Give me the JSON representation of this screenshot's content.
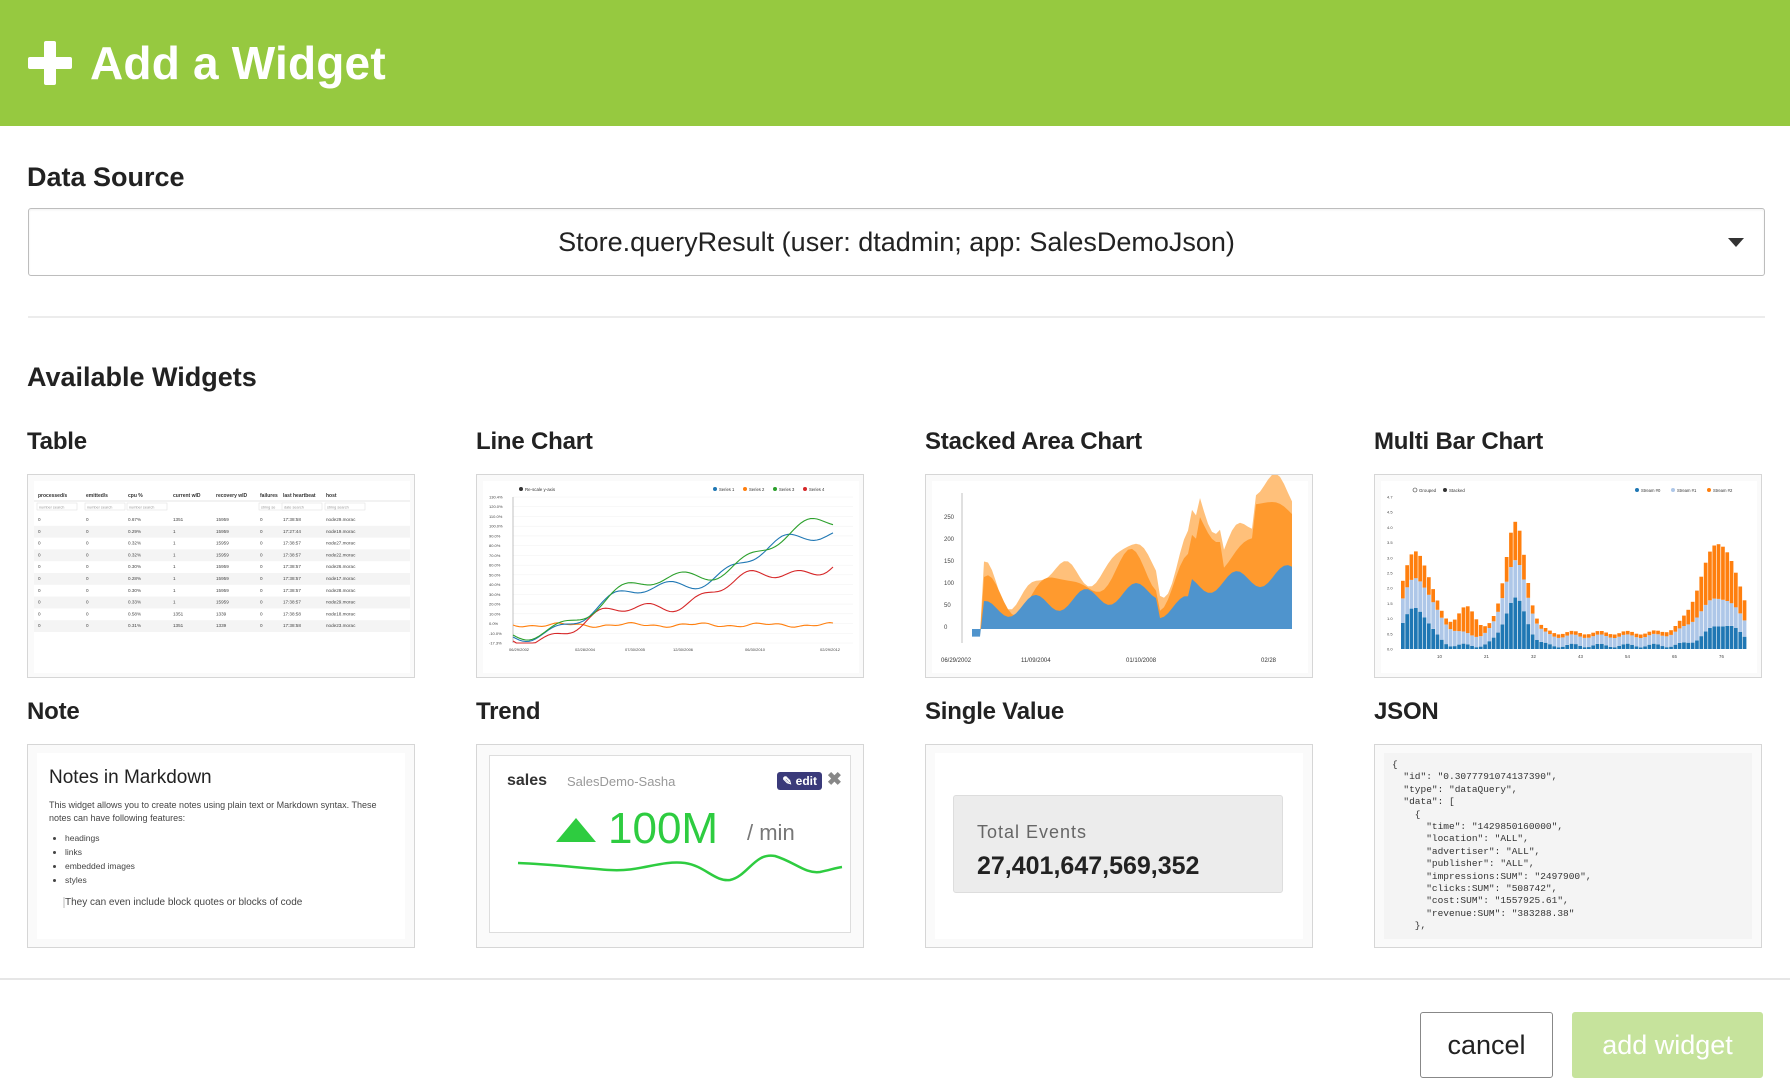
{
  "header": {
    "title": "Add a Widget",
    "icon": "plus-icon",
    "color": "#96c940"
  },
  "data_source": {
    "label": "Data Source",
    "selected": "Store.queryResult (user: dtadmin; app: SalesDemoJson)"
  },
  "available": {
    "label": "Available Widgets"
  },
  "widgets": [
    {
      "name": "Table"
    },
    {
      "name": "Line Chart"
    },
    {
      "name": "Stacked Area Chart"
    },
    {
      "name": "Multi Bar Chart"
    },
    {
      "name": "Note"
    },
    {
      "name": "Trend"
    },
    {
      "name": "Single Value"
    },
    {
      "name": "JSON"
    }
  ],
  "table_preview": {
    "headers": [
      "processed/s",
      "emitted/s",
      "cpu %",
      "current wID",
      "recovery wID",
      "failures",
      "last heartbeat",
      "host"
    ],
    "search": [
      "number search",
      "number search",
      "number search",
      "",
      "",
      "string se",
      "date search",
      "string search"
    ],
    "rows": [
      [
        "0",
        "0",
        "0.67%",
        "1351",
        "15959",
        "0",
        "17:38:58",
        "node29.morac"
      ],
      [
        "0",
        "0",
        "0.29%",
        "1",
        "15959",
        "0",
        "17:27:44",
        "node19.morac"
      ],
      [
        "0",
        "0",
        "0.32%",
        "1",
        "15959",
        "0",
        "17:38:57",
        "node27.morac"
      ],
      [
        "0",
        "0",
        "0.32%",
        "1",
        "15959",
        "0",
        "17:38:57",
        "node22.morac"
      ],
      [
        "0",
        "0",
        "0.30%",
        "1",
        "15959",
        "0",
        "17:38:57",
        "node26.morac"
      ],
      [
        "0",
        "0",
        "0.28%",
        "1",
        "15959",
        "0",
        "17:38:57",
        "node17.morac"
      ],
      [
        "0",
        "0",
        "0.30%",
        "1",
        "15959",
        "0",
        "17:38:57",
        "node28.morac"
      ],
      [
        "0",
        "0",
        "0.33%",
        "1",
        "15959",
        "0",
        "17:38:57",
        "node29.morac"
      ],
      [
        "0",
        "0",
        "0.58%",
        "1351",
        "1339",
        "0",
        "17:38:58",
        "node18.morac"
      ],
      [
        "0",
        "0",
        "0.31%",
        "1351",
        "1339",
        "0",
        "17:38:58",
        "node23.morac"
      ]
    ]
  },
  "line_preview": {
    "legend_left": "Re-scale y-axis",
    "legend": [
      "Series 1",
      "Series 2",
      "Series 3",
      "Series 4"
    ],
    "yticks": [
      "130.4%",
      "120.0%",
      "110.0%",
      "100.0%",
      "90.0%",
      "80.0%",
      "70.0%",
      "60.0%",
      "50.0%",
      "40.0%",
      "30.0%",
      "20.0%",
      "10.0%",
      "0.0%",
      "-10.0%",
      "-17.3%"
    ],
    "xticks": [
      "06/29/2002",
      "02/28/2004",
      "07/30/2005",
      "12/30/2006",
      "06/30/2010",
      "02/29/2012"
    ]
  },
  "area_preview": {
    "yticks": [
      "250",
      "200",
      "150",
      "100",
      "50",
      "0"
    ],
    "xticks": [
      "06/29/2002",
      "11/09/2004",
      "01/10/2008",
      "02/28"
    ]
  },
  "bar_preview": {
    "modes": [
      "Grouped",
      "Stacked"
    ],
    "legend": [
      "Stream #0",
      "Stream #1",
      "Stream #2"
    ],
    "yticks": [
      "4.7",
      "4.5",
      "4.0",
      "3.5",
      "3.0",
      "2.5",
      "2.0",
      "1.5",
      "1.0",
      "0.5",
      "0.0"
    ],
    "xticks": [
      "10",
      "21",
      "32",
      "43",
      "54",
      "65",
      "76"
    ]
  },
  "note_preview": {
    "title": "Notes in Markdown",
    "body": "This widget allows you to create notes using plain text or Markdown syntax. These notes can have following features:",
    "items": [
      "headings",
      "links",
      "embedded images",
      "styles"
    ],
    "quote": "They can even include block quotes or blocks of code"
  },
  "trend_preview": {
    "title": "sales",
    "subtitle": "SalesDemo-Sasha",
    "edit": "edit",
    "close": "✖",
    "value": "100M",
    "unit": "/ min",
    "color": "#2ecc40"
  },
  "single_value_preview": {
    "label": "Total Events",
    "value": "27,401,647,569,352"
  },
  "json_preview": {
    "text": "{\n  \"id\": \"0.3077791074137390\",\n  \"type\": \"dataQuery\",\n  \"data\": [\n    {\n      \"time\": \"1429850160000\",\n      \"location\": \"ALL\",\n      \"advertiser\": \"ALL\",\n      \"publisher\": \"ALL\",\n      \"impressions:SUM\": \"2497900\",\n      \"clicks:SUM\": \"508742\",\n      \"cost:SUM\": \"1557925.61\",\n      \"revenue:SUM\": \"383288.38\"\n    },"
  },
  "footer": {
    "cancel": "cancel",
    "add": "add widget",
    "add_color": "#c6e39c"
  },
  "colors": {
    "series1": "#1f77b4",
    "series2": "#ff7f0e",
    "series3": "#2ca02c",
    "series4": "#d62728",
    "area_blue": "#4f94cd",
    "area_orange": "#ff9a2e",
    "area_light": "#ffc07a"
  }
}
